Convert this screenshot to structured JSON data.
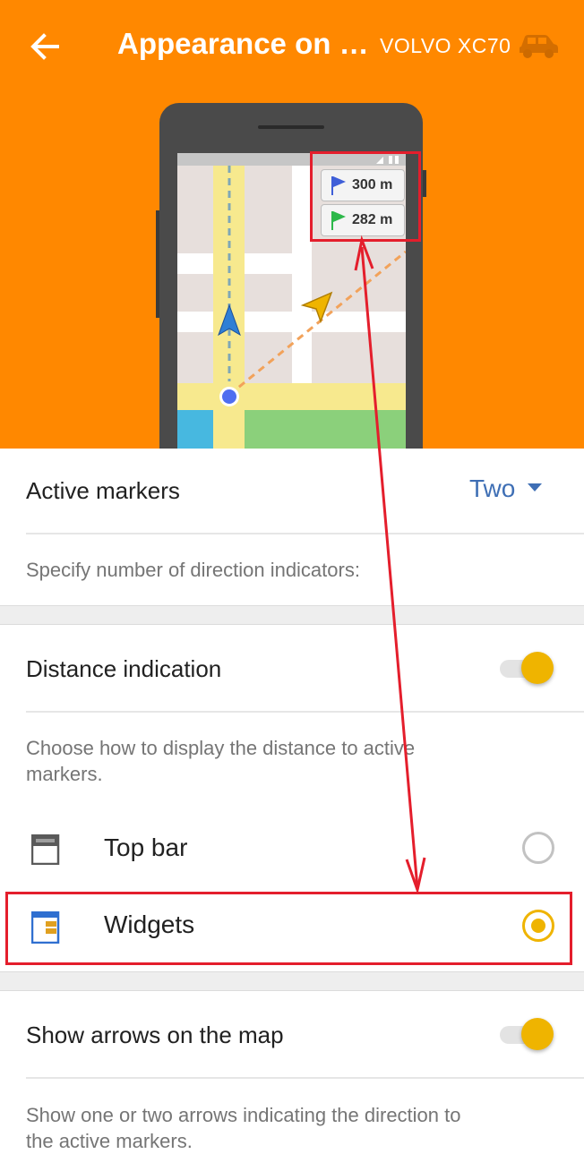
{
  "header": {
    "title": "Appearance on t…",
    "profile_name": "VOLVO XC70",
    "background_color": "#ff8800",
    "back_icon": "arrow-left-icon",
    "profile_icon": "car-icon"
  },
  "illustration": {
    "widget_1": {
      "distance": "300 m",
      "flag_color": "#3f5fd8"
    },
    "widget_2": {
      "distance": "282 m",
      "flag_color": "#2db84a"
    }
  },
  "active_markers": {
    "label": "Active markers",
    "value": "Two",
    "description": "Specify number of direction indicators:"
  },
  "distance_indication": {
    "label": "Distance indication",
    "enabled": true,
    "description_line1": "Choose how to display the distance to active",
    "description_line2": "markers.",
    "options": [
      {
        "label": "Top bar",
        "selected": false,
        "icon": "top-bar-icon"
      },
      {
        "label": "Widgets",
        "selected": true,
        "icon": "widgets-icon"
      }
    ]
  },
  "show_arrows": {
    "label": "Show arrows on the map",
    "enabled": true,
    "description_line1": "Show one or two arrows indicating the direction to",
    "description_line2": "the active markers."
  },
  "colors": {
    "accent": "#efb400",
    "link": "#3f6fb5",
    "annotation": "#e41e2c"
  }
}
